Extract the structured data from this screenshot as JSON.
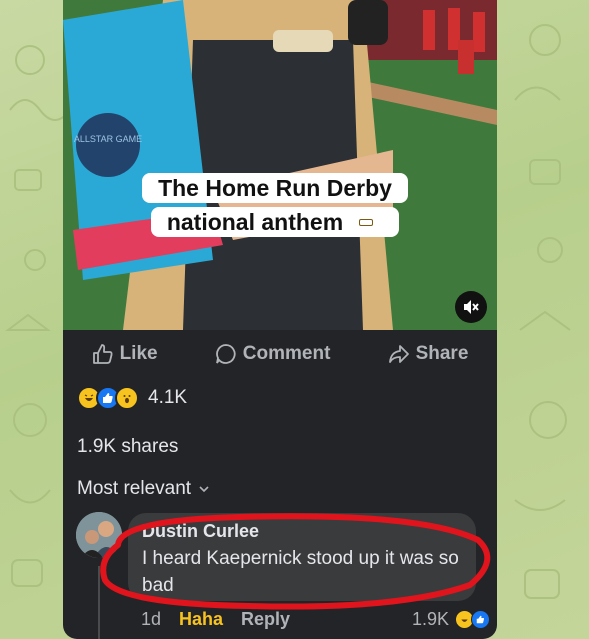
{
  "video": {
    "caption": "The Home Run Derby national anthem",
    "caption_emoji": "grimacing-face-emoji",
    "badge_text": "ALLSTAR GAME",
    "mute_icon": "speaker-muted-icon"
  },
  "actions": {
    "like_label": "Like",
    "comment_label": "Comment",
    "share_label": "Share"
  },
  "stats": {
    "reactions": [
      "haha",
      "like",
      "wow"
    ],
    "reaction_count": "4.1K",
    "shares_text": "1.9K shares"
  },
  "comments_filter": {
    "label": "Most relevant"
  },
  "comment": {
    "author": "Dustin Curlee",
    "text": "I heard Kaepernick stood up it was so bad",
    "time": "1d",
    "reaction_label": "Haha",
    "reply_label": "Reply",
    "reaction_count": "1.9K",
    "reactions": [
      "haha",
      "like"
    ]
  },
  "colors": {
    "background_green": "#c4d59a",
    "card_bg": "#232427",
    "bubble_bg": "#3a3b3c",
    "haha_yellow": "#f7c31f",
    "like_blue": "#1877f2",
    "annotation_red": "#e0141c"
  }
}
